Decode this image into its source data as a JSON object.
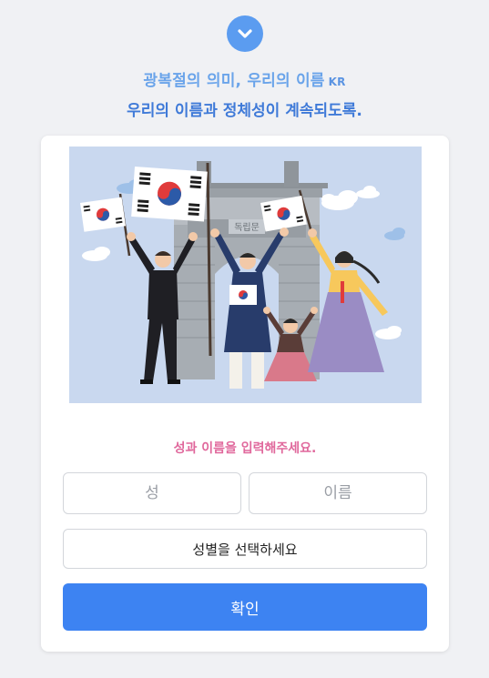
{
  "header": {
    "title_line1": "광복절의 의미, 우리의 이름",
    "lang_badge": "KR",
    "title_line2": "우리의 이름과 정체성이 계속되도록."
  },
  "illustration": {
    "gate_sign": "독립문"
  },
  "form": {
    "prompt": "성과 이름을 입력해주세요.",
    "last_name_placeholder": "성",
    "first_name_placeholder": "이름",
    "gender_select_label": "성별을 선택하세요",
    "confirm_label": "확인"
  },
  "colors": {
    "accent_blue": "#3d83f2",
    "prompt_pink": "#e0689c",
    "background": "#f0f1f4"
  }
}
